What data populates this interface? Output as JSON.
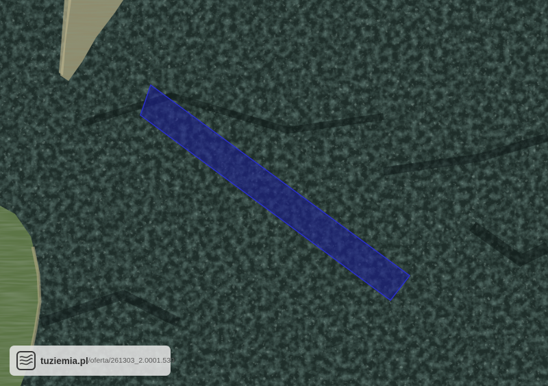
{
  "map": {
    "type": "satellite",
    "colors": {
      "forest_base": "#1f2e2a",
      "forest_dark": "#0f1a18",
      "forest_light": "#3d524a",
      "field_green": "#5f7a4e",
      "field_tan": "#a39a78",
      "parcel_fill": "#1c1e9a",
      "parcel_stroke": "#2a2fd0"
    }
  },
  "watermark": {
    "logo": "tuziemia-logo-icon",
    "brand": "tuziemia.pl",
    "path": "/oferta/261303_2.0001.539"
  }
}
